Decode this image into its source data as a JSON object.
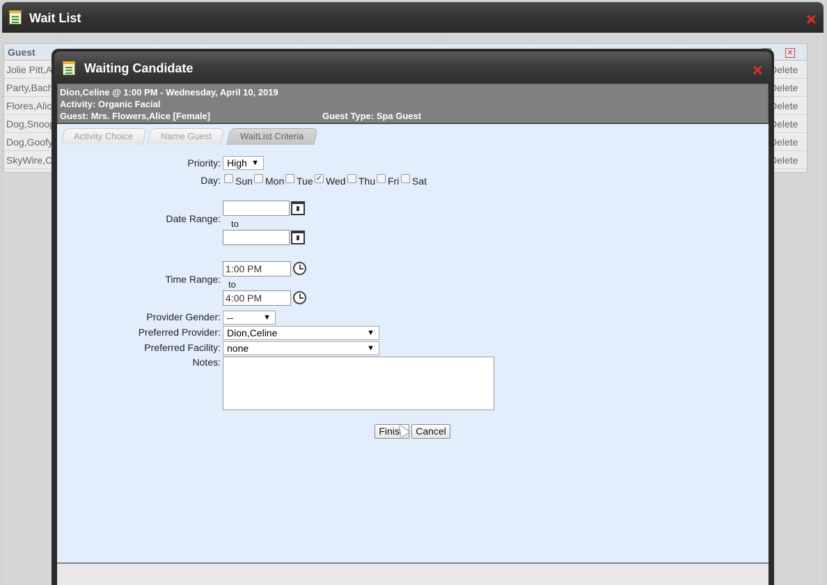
{
  "outer_window": {
    "title": "Wait List",
    "table_header_guest": "Guest",
    "rows": [
      {
        "guest": "Jolie Pitt,A",
        "action": "Delete"
      },
      {
        "guest": "Party,Bach",
        "action": "Delete"
      },
      {
        "guest": "Flores,Alic",
        "action": "Delete"
      },
      {
        "guest": "Dog,Snoop",
        "action": "Delete"
      },
      {
        "guest": "Dog,Goofy",
        "action": "Delete"
      },
      {
        "guest": "SkyWire,C",
        "action": "Delete"
      }
    ],
    "icons": [
      "notepad-icon",
      "close-icon"
    ]
  },
  "modal": {
    "title": "Waiting Candidate",
    "info_line1": "Dion,Celine @ 1:00 PM - Wednesday, April 10, 2019",
    "info_line2": "Activity: Organic Facial",
    "info_guest": "Guest: Mrs. Flowers,Alice [Female]",
    "info_guest_type": "Guest Type: Spa Guest",
    "tabs": [
      {
        "label": "Activity Choice",
        "active": false
      },
      {
        "label": "Name Guest",
        "active": false
      },
      {
        "label": "WaitList Criteria",
        "active": true
      }
    ]
  },
  "form": {
    "priority_label": "Priority:",
    "priority_value": "High",
    "day_label": "Day:",
    "days": [
      {
        "label": "Sun",
        "checked": false
      },
      {
        "label": "Mon",
        "checked": false
      },
      {
        "label": "Tue",
        "checked": false
      },
      {
        "label": "Wed",
        "checked": true
      },
      {
        "label": "Thu",
        "checked": false
      },
      {
        "label": "Fri",
        "checked": false
      },
      {
        "label": "Sat",
        "checked": false
      }
    ],
    "date_range_label": "Date Range:",
    "date_from": "",
    "date_to": "",
    "to_label": "to",
    "time_range_label": "Time Range:",
    "time_from": "1:00 PM",
    "time_to": "4:00 PM",
    "provider_gender_label": "Provider Gender:",
    "provider_gender_value": "--",
    "preferred_provider_label": "Preferred Provider:",
    "preferred_provider_value": "Dion,Celine",
    "preferred_facility_label": "Preferred Facility:",
    "preferred_facility_value": "none",
    "notes_label": "Notes:",
    "notes_value": "",
    "finish_label": "Finish",
    "cancel_label": "Cancel"
  },
  "colors": {
    "titlebar": "#333333",
    "close_x": "#e8321a",
    "info_band": "#808080",
    "content_bg": "#e2eefc"
  }
}
